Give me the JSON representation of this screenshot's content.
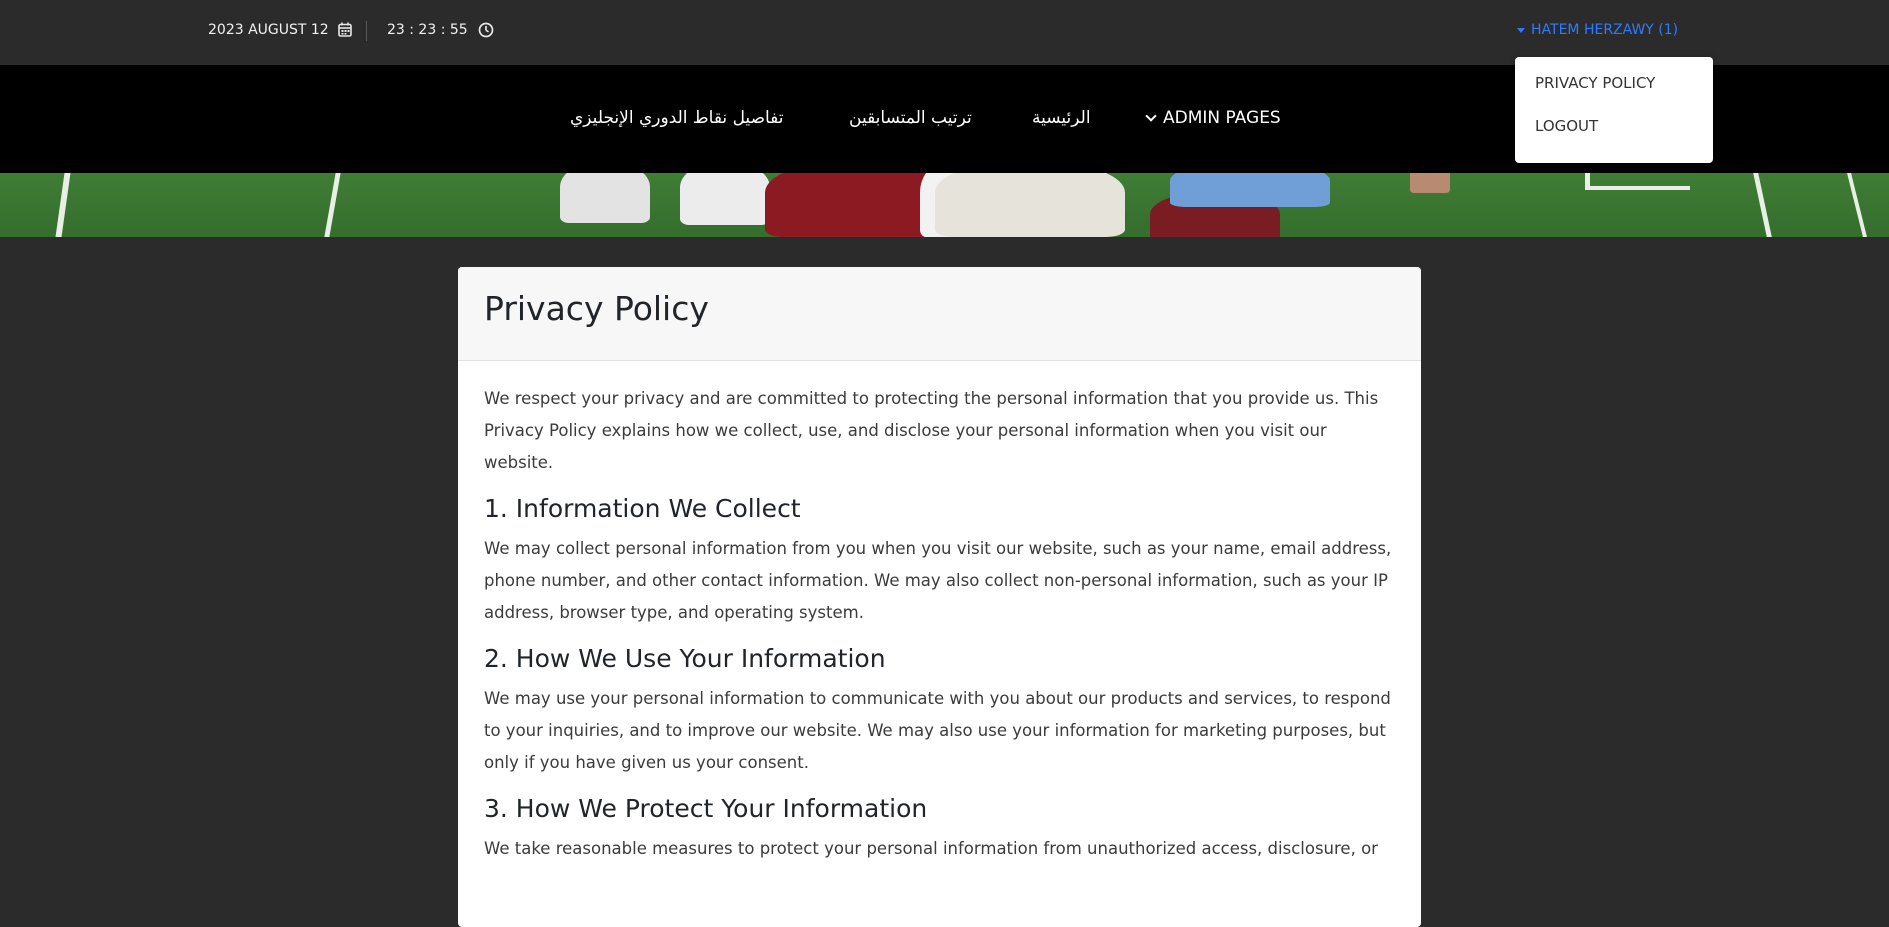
{
  "topbar": {
    "date_text": "2023 AUGUST 12",
    "time_text": "23 : 23 : 55",
    "user_label": "HATEM HERZAWY (1)"
  },
  "user_menu": {
    "items": [
      {
        "label": "PRIVACY POLICY"
      },
      {
        "label": "LOGOUT"
      }
    ]
  },
  "nav": {
    "admin_label": "ADMIN PAGES",
    "home_label": "الرئيسية",
    "standings_label": "ترتيب المتسابقين",
    "points_label": "تفاصيل نقاط الدوري الإنجليزي"
  },
  "page": {
    "title": "Privacy Policy",
    "intro": "We respect your privacy and are committed to protecting the personal information that you provide us. This Privacy Policy explains how we collect, use, and disclose your personal information when you visit our website.",
    "sections": [
      {
        "heading": "1. Information We Collect",
        "text": "We may collect personal information from you when you visit our website, such as your name, email address, phone number, and other contact information. We may also collect non-personal information, such as your IP address, browser type, and operating system."
      },
      {
        "heading": "2. How We Use Your Information",
        "text": "We may use your personal information to communicate with you about our products and services, to respond to your inquiries, and to improve our website. We may also use your information for marketing purposes, but only if you have given us your consent."
      },
      {
        "heading": "3. How We Protect Your Information",
        "text": "We take reasonable measures to protect your personal information from unauthorized access, disclosure, or"
      }
    ]
  },
  "colors": {
    "topbar_bg": "#2b2b2b",
    "navbar_bg": "#000000",
    "user_link": "#2f7bff",
    "card_bg": "#ffffff"
  },
  "icons": {
    "date": "calendar-icon",
    "time": "clock-icon",
    "user_caret": "caret-down-icon",
    "admin_chevron": "chevron-down-icon"
  }
}
